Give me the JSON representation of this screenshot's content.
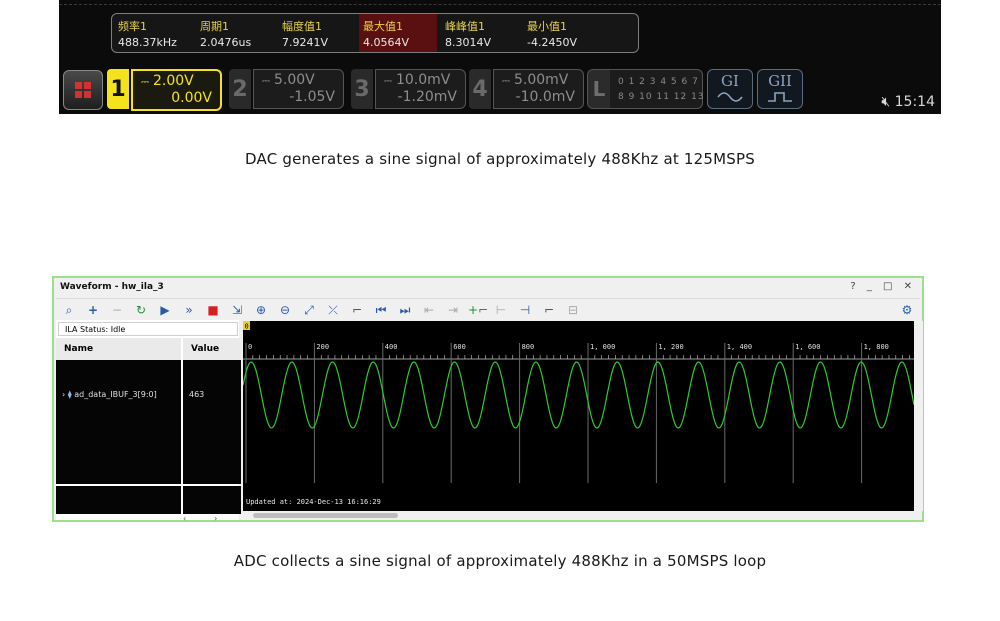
{
  "scope": {
    "measurements": [
      {
        "label": "频率1",
        "value": "488.37kHz",
        "highlight": false
      },
      {
        "label": "周期1",
        "value": "2.0476us",
        "highlight": false
      },
      {
        "label": "幅度值1",
        "value": "7.9241V",
        "highlight": false
      },
      {
        "label": "最大值1",
        "value": "4.0564V",
        "highlight": true
      },
      {
        "label": "峰峰值1",
        "value": "8.3014V",
        "highlight": false
      },
      {
        "label": "最小值1",
        "value": "-4.2450V",
        "highlight": false
      }
    ],
    "channels": [
      {
        "num": "1",
        "scale": "2.00V",
        "offset": "0.00V",
        "active": true
      },
      {
        "num": "2",
        "scale": "5.00V",
        "offset": "-1.05V",
        "active": false
      },
      {
        "num": "3",
        "scale": "10.0mV",
        "offset": "-1.20mV",
        "active": false
      },
      {
        "num": "4",
        "scale": "5.00mV",
        "offset": "-10.0mV",
        "active": false
      }
    ],
    "logic": {
      "label": "L",
      "row1": "0 1 2 3  4 5 6 7",
      "row2": "8 9 10 11 12 13 14 15"
    },
    "generators": [
      {
        "label": "GI",
        "icon": "sine-wave"
      },
      {
        "label": "GII",
        "icon": "pulse-wave"
      }
    ],
    "time": "15:14",
    "speaker_icon": "speaker-muted-icon",
    "colors": {
      "ch1": "#f4e21d",
      "highlight": "#5a1010"
    }
  },
  "captions": {
    "dac": "DAC generates a sine signal of approximately 488Khz at 125MSPS",
    "adc": "ADC collects a sine signal of approximately 488Khz in a 50MSPS loop"
  },
  "waveform_window": {
    "title": "Waveform - hw_ila_3",
    "controls": "? _ □ ✕",
    "ila_status": "ILA Status: Idle",
    "columns": {
      "name": "Name",
      "value": "Value"
    },
    "signal": {
      "name": "ad_data_IBUF_3[9:0]",
      "value": "463"
    },
    "marker": "0",
    "ruler": [
      "0",
      "200",
      "400",
      "600",
      "800",
      "1, 000",
      "1, 200",
      "1, 400",
      "1, 600",
      "1, 800"
    ],
    "updated": "Updated at: 2024-Dec-13 16:16:29",
    "toolbar_icons": [
      "search-icon",
      "add-icon",
      "remove-icon",
      "refresh-icon",
      "run-icon",
      "run-all-icon",
      "stop-icon",
      "export-icon",
      "zoom-in-icon",
      "zoom-out-icon",
      "zoom-fit-icon",
      "cursor-icon",
      "marker-icon",
      "go-first-icon",
      "go-last-icon",
      "prev-marker-icon",
      "next-marker-icon",
      "add-marker-icon",
      "prev-edge-icon",
      "next-edge-icon",
      "swap-icon",
      "remove-marker-icon",
      "delta-icon",
      "gear-icon"
    ],
    "wave_color": "#2ecc2e",
    "wave_periods": 16.5
  }
}
